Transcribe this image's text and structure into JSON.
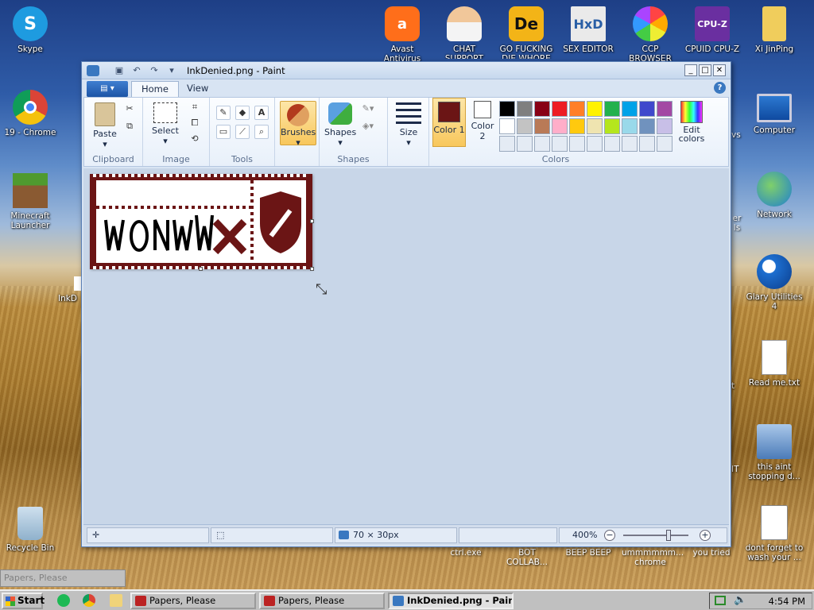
{
  "desktop": {
    "left_icons": [
      {
        "label": "Skype"
      },
      {
        "label": "19 - Chrome"
      },
      {
        "label": "Minecraft Launcher"
      },
      {
        "label": "InkD"
      },
      {
        "label": "Recycle Bin"
      }
    ],
    "top_icons": [
      {
        "label": "Avast Antivirus"
      },
      {
        "label": "CHAT SUPPORT"
      },
      {
        "label": "GO FUCKING DIE WHORE"
      },
      {
        "label": "SEX EDITOR"
      },
      {
        "label": "CCP BROWSER"
      },
      {
        "label": "CPUID CPU-Z"
      },
      {
        "label": "Xi JinPing"
      }
    ],
    "right_icons": [
      {
        "label": "Computer"
      },
      {
        "label": "Network"
      },
      {
        "label": "Glary Utilities 4"
      },
      {
        "label": "Read me.txt"
      },
      {
        "label": "this aint stopping d..."
      },
      {
        "label": "dont forget to wash your ..."
      }
    ],
    "behind_right_labels": [
      "vs",
      "er ls",
      "t",
      "IT"
    ],
    "bottom_labels": [
      "ctrl.exe",
      "BOT COLLAB...",
      "BEEP BEEP",
      "ummmmmm... chrome",
      "you tried"
    ]
  },
  "paint": {
    "title": "InkDenied.png - Paint",
    "tabs": [
      "Home",
      "View"
    ],
    "clipboard": {
      "paste": "Paste",
      "label": "Clipboard"
    },
    "image_group": {
      "select": "Select",
      "label": "Image"
    },
    "tools": {
      "label": "Tools"
    },
    "brushes": "Brushes",
    "shapes": {
      "button": "Shapes",
      "label": "Shapes"
    },
    "size": "Size",
    "color1": {
      "label": "Color 1",
      "value": "#6b1515"
    },
    "color2": {
      "label": "Color 2",
      "value": "#ffffff"
    },
    "colors_label": "Colors",
    "edit_colors": "Edit colors",
    "palette": [
      "#000000",
      "#7f7f7f",
      "#880015",
      "#ed1c24",
      "#ff7f27",
      "#fff200",
      "#22b14c",
      "#00a2e8",
      "#3f48cc",
      "#a349a4",
      "#ffffff",
      "#c3c3c3",
      "#b97a57",
      "#ffaec9",
      "#ffc90e",
      "#efe4b0",
      "#b5e61d",
      "#99d9ea",
      "#7092be",
      "#c8bfe7"
    ],
    "status": {
      "dimensions": "70 × 30px",
      "zoom": "400%"
    },
    "image_text": "WONNW"
  },
  "taskbar": {
    "selection_title": "Papers, Please",
    "start": "Start",
    "tasks": [
      "Papers, Please",
      "Papers, Please",
      "InkDenied.png - Paint"
    ],
    "clock": "4:54 PM"
  }
}
